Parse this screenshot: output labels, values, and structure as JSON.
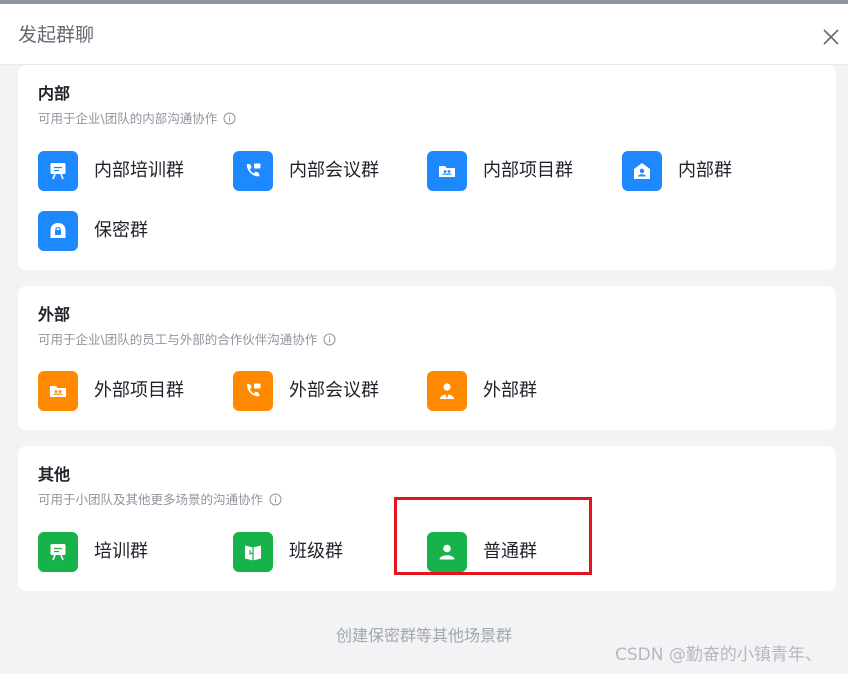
{
  "dialog": {
    "title": "发起群聊"
  },
  "sections": [
    {
      "title": "内部",
      "description": "可用于企业\\团队的内部沟通协作",
      "items": [
        {
          "label": "内部培训群",
          "icon": "training-board-icon",
          "color": "#1e88ff"
        },
        {
          "label": "内部会议群",
          "icon": "meeting-phone-icon",
          "color": "#1e88ff"
        },
        {
          "label": "内部项目群",
          "icon": "project-folder-icon",
          "color": "#1e88ff"
        },
        {
          "label": "内部群",
          "icon": "home-user-icon",
          "color": "#1e88ff"
        },
        {
          "label": "保密群",
          "icon": "lock-icon",
          "color": "#1e88ff"
        }
      ]
    },
    {
      "title": "外部",
      "description": "可用于企业\\团队的员工与外部的合作伙伴沟通协作",
      "items": [
        {
          "label": "外部项目群",
          "icon": "project-folder-icon",
          "color": "#ff8a00"
        },
        {
          "label": "外部会议群",
          "icon": "meeting-phone-icon",
          "color": "#ff8a00"
        },
        {
          "label": "外部群",
          "icon": "business-user-icon",
          "color": "#ff8a00"
        }
      ]
    },
    {
      "title": "其他",
      "description": "可用于小团队及其他更多场景的沟通协作",
      "items": [
        {
          "label": "培训群",
          "icon": "training-board-icon",
          "color": "#18b24b"
        },
        {
          "label": "班级群",
          "icon": "book-icon",
          "color": "#18b24b"
        },
        {
          "label": "普通群",
          "icon": "user-icon",
          "color": "#18b24b"
        }
      ]
    }
  ],
  "footer": {
    "link": "创建保密群等其他场景群"
  },
  "watermark": "CSDN @勤奋的小镇青年、",
  "colors": {
    "highlight": "#e3141d",
    "background": "#f2f3f5"
  }
}
